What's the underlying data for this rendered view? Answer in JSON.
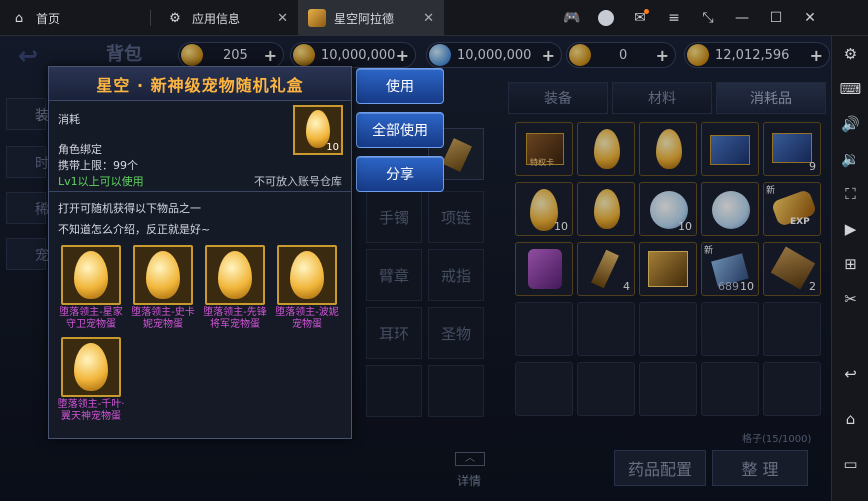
{
  "window": {
    "tabs": [
      {
        "label": "首页",
        "icon": "home-icon"
      },
      {
        "label": "应用信息",
        "icon": "gear-icon"
      },
      {
        "label": "星空阿拉德",
        "icon": "game-icon"
      }
    ],
    "controls": [
      "gamepad-icon",
      "account-icon",
      "mail-icon",
      "menu-icon",
      "shrink-icon",
      "minimize-icon",
      "maximize-icon",
      "close-icon"
    ]
  },
  "game": {
    "header_title": "背包",
    "currencies": [
      "205",
      "10,000,000",
      "10,000,000",
      "0",
      "12,012,596"
    ],
    "tabs": [
      "装备",
      "材料",
      "消耗品"
    ],
    "side_tabs": [
      "装",
      "时",
      "稀",
      "宠"
    ],
    "equip_slots": [
      "手镯",
      "项链",
      "臂章",
      "戒指",
      "耳环",
      "圣物"
    ],
    "grid_counts": {
      "r1c2": "9",
      "r2c1": "10",
      "r2c3": "10",
      "r3c2": "4",
      "r3c4": "10",
      "r3c5": "689",
      "r3c6": "2"
    },
    "grid_badges": {
      "special_card": "特权卡",
      "new": "新",
      "exp": "EXP"
    },
    "capacity": "格子(15/1000)",
    "detail_label": "详情",
    "btn_potion": "药品配置",
    "btn_sort": "整 理"
  },
  "popup": {
    "title": "星空 · 新神级宠物随机礼盒",
    "type": "消耗",
    "bind": "角色绑定",
    "carry_limit": "携带上限：99个",
    "level_req": "Lv1以上可以使用",
    "warehouse_note": "不可放入账号仓库",
    "item_count": "10",
    "desc1": "打开可随机获得以下物品之一",
    "desc2": "不知道怎么介绍，反正就是好~",
    "rewards": [
      {
        "name": "堕落领主-星家守卫宠物蛋"
      },
      {
        "name": "堕落领主-史卡妮宠物蛋"
      },
      {
        "name": "堕落领主-先锋将军宠物蛋"
      },
      {
        "name": "堕落领主-波妮宠物蛋"
      },
      {
        "name": "堕落领主-千叶·翼天神宠物蛋"
      }
    ]
  },
  "actions": {
    "use": "使用",
    "use_all": "全部使用",
    "share": "分享"
  },
  "colors": {
    "title_orange": "#ffb640",
    "level_green": "#5ed35e",
    "reward_purple": "#d255d8",
    "button_blue": "#2d66c8"
  }
}
